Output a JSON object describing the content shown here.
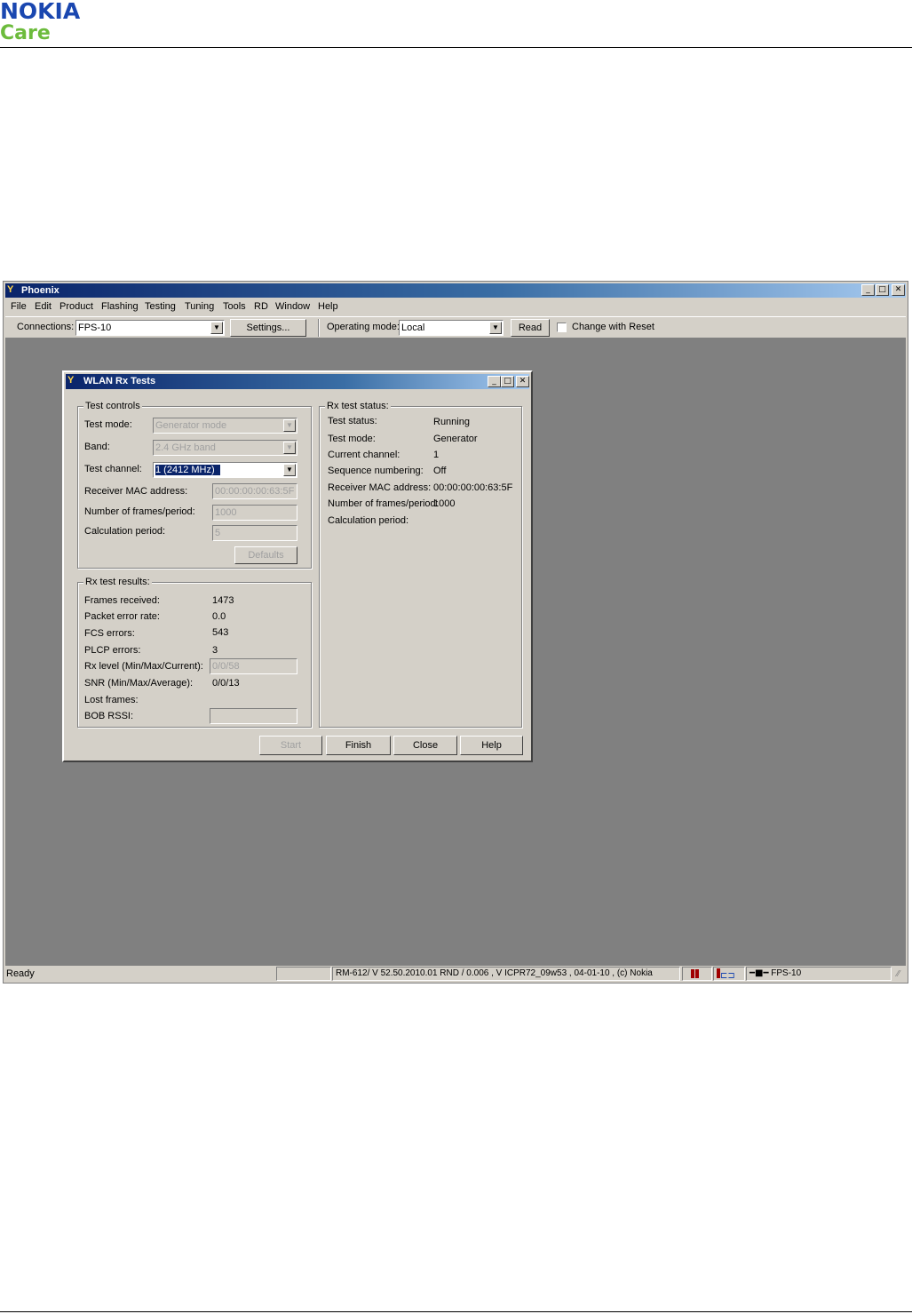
{
  "header": {
    "brand": "NOKIA",
    "sub_brand": "Care"
  },
  "app": {
    "title": "Phoenix",
    "menu": [
      "File",
      "Edit",
      "Product",
      "Flashing",
      "Testing",
      "Tuning",
      "Tools",
      "RD",
      "Window",
      "Help"
    ],
    "toolbar": {
      "connections_label": "Connections:",
      "connections_value": "FPS-10",
      "settings_button": "Settings...",
      "operating_mode_label": "Operating mode:",
      "operating_mode_value": "Local",
      "read_button": "Read",
      "change_with_reset_label": "Change with Reset"
    },
    "status": {
      "ready": "Ready",
      "version": "RM-612/ V 52.50.2010.01 RND / 0.006 , V ICPR72_09w53 , 04-01-10 , (c) Nokia",
      "connection": "FPS-10"
    }
  },
  "dialog": {
    "title": "WLAN Rx Tests",
    "test_controls": {
      "title": "Test controls",
      "test_mode_label": "Test mode:",
      "test_mode_value": "Generator mode",
      "band_label": "Band:",
      "band_value": "2.4 GHz band",
      "test_channel_label": "Test channel:",
      "test_channel_value": "1 (2412 MHz)",
      "receiver_mac_label": "Receiver MAC address:",
      "receiver_mac_value": "00:00:00:00:63:5F",
      "frames_period_label": "Number of frames/period:",
      "frames_period_value": "1000",
      "calc_period_label": "Calculation period:",
      "calc_period_value": "5",
      "defaults_button": "Defaults"
    },
    "rx_results": {
      "title": "Rx test results:",
      "rows": [
        {
          "label": "Frames received:",
          "value": "1473"
        },
        {
          "label": "Packet error rate:",
          "value": "0.0"
        },
        {
          "label": "FCS errors:",
          "value": "543"
        },
        {
          "label": "PLCP errors:",
          "value": "3"
        }
      ],
      "rx_level_label": "Rx level (Min/Max/Current):",
      "rx_level_value": "0/0/58",
      "snr_label": "SNR (Min/Max/Average):",
      "snr_value": "0/0/13",
      "lost_frames_label": "Lost frames:",
      "bob_rssi_label": "BOB RSSI:"
    },
    "rx_status": {
      "title": "Rx test status:",
      "rows": [
        {
          "label": "Test status:",
          "value": "Running"
        },
        {
          "label": "Test mode:",
          "value": "Generator"
        },
        {
          "label": "Current channel:",
          "value": "1"
        },
        {
          "label": "Sequence numbering:",
          "value": "Off"
        },
        {
          "label": "Receiver MAC address:",
          "value": "00:00:00:00:63:5F"
        },
        {
          "label": "Number of frames/period:",
          "value": "1000"
        },
        {
          "label": "Calculation period:",
          "value": ""
        }
      ]
    },
    "buttons": {
      "start": "Start",
      "finish": "Finish",
      "close": "Close",
      "help": "Help"
    }
  }
}
